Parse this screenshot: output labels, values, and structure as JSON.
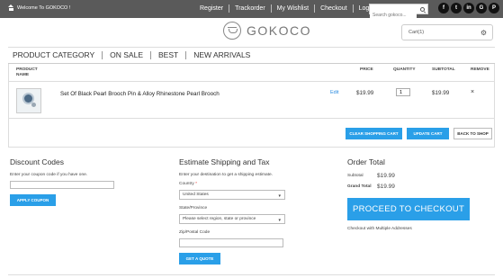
{
  "topbar": {
    "welcome": "Welcome To GOKOCO !",
    "links": [
      "Register",
      "Trackorder",
      "My Wishlist",
      "Checkout",
      "Log In"
    ],
    "search_placeholder": "Search gokoco...",
    "social": [
      "f",
      "t",
      "in",
      "G",
      "P"
    ]
  },
  "header": {
    "logo_text": "GOKOCO",
    "cart_label": "Cart(1)"
  },
  "category_nav": [
    "PRODUCT CATEGORY",
    "ON SALE",
    "BEST",
    "NEW ARRIVALS"
  ],
  "cart": {
    "columns": {
      "product_name": "PRODUCT NAME",
      "price": "PRICE",
      "quantity": "QUANTITY",
      "subtotal": "SUBTOTAL",
      "remove": "REMOVE"
    },
    "items": [
      {
        "name": "Set Of Black Pearl Brooch Pin & Alloy Rhinestone Pearl Brooch",
        "edit": "Edit",
        "price": "$19.99",
        "qty": "1",
        "subtotal": "$19.99",
        "remove": "×"
      }
    ],
    "buttons": {
      "clear": "CLEAR SHOPPING CART",
      "update": "UPDATE CART",
      "back": "BACK TO SHOP"
    }
  },
  "discount": {
    "title": "Discount Codes",
    "prompt": "Enter your coupon code if you have one.",
    "code_value": "",
    "apply": "APPLY COUPON"
  },
  "shipping": {
    "title": "Estimate Shipping and Tax",
    "prompt": "Enter your destination to get a shipping estimate.",
    "country_label": "Country",
    "country_required": "*",
    "country_value": "United States",
    "state_label": "State/Province",
    "state_value": "Please select region, state or province",
    "zip_label": "Zip/Postal Code",
    "zip_value": "",
    "quote": "GET A QUOTE"
  },
  "totals": {
    "title": "Order Total",
    "subtotal_label": "Subtotal",
    "subtotal_value": "$19.99",
    "grand_label": "Grand Total",
    "grand_value": "$19.99",
    "checkout": "PROCEED TO CHECKOUT",
    "multi": "Checkout with Multiple Addresses"
  },
  "colors": {
    "topbar": "#5a5a5a",
    "accent_blue": "#2a9fe8"
  }
}
